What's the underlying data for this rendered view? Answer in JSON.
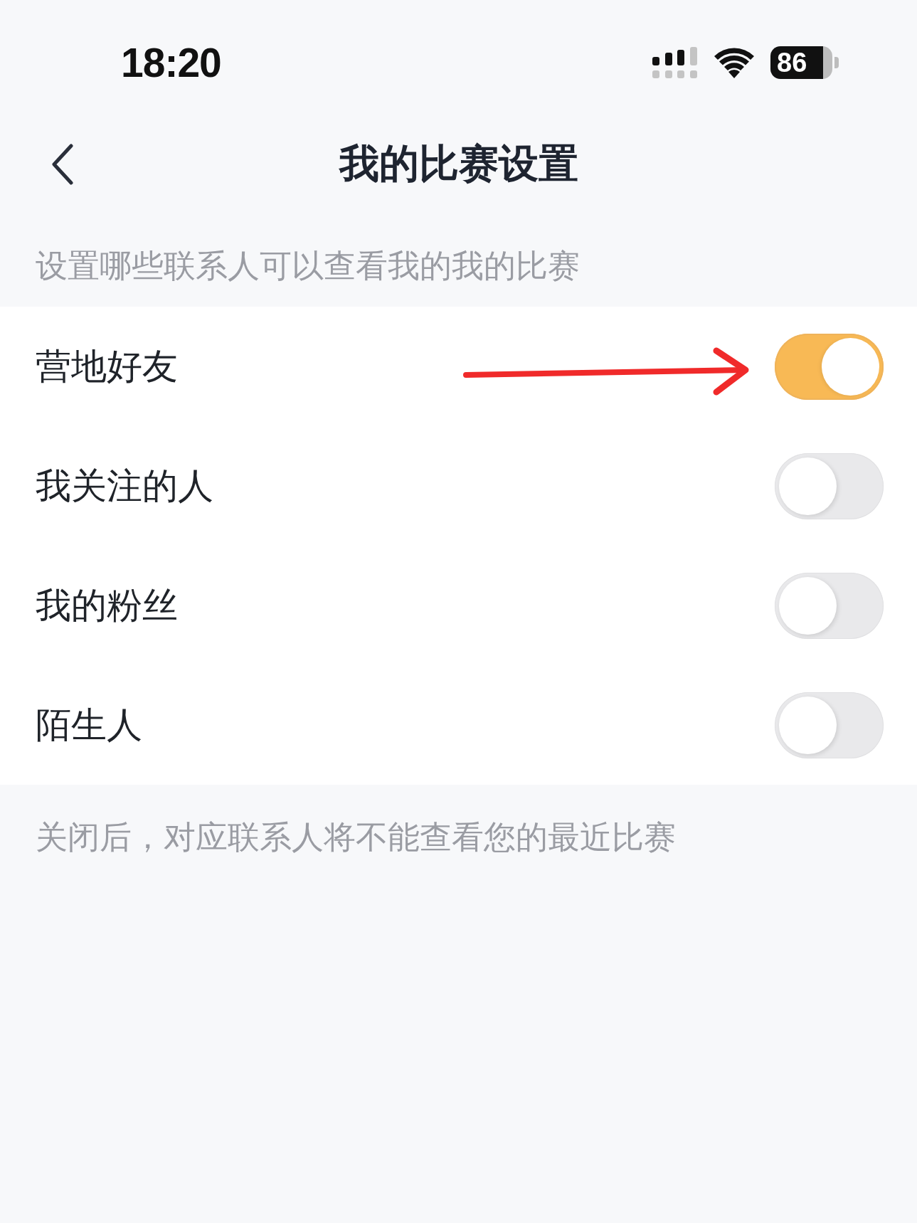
{
  "status_bar": {
    "time": "18:20",
    "battery": "86"
  },
  "nav_bar": {
    "title": "我的比赛设置"
  },
  "section_header": "设置哪些联系人可以查看我的我的比赛",
  "settings": [
    {
      "label": "营地好友",
      "on": true
    },
    {
      "label": "我关注的人",
      "on": false
    },
    {
      "label": "我的粉丝",
      "on": false
    },
    {
      "label": "陌生人",
      "on": false
    }
  ],
  "footer_note": "关闭后，对应联系人将不能查看您的最近比赛"
}
